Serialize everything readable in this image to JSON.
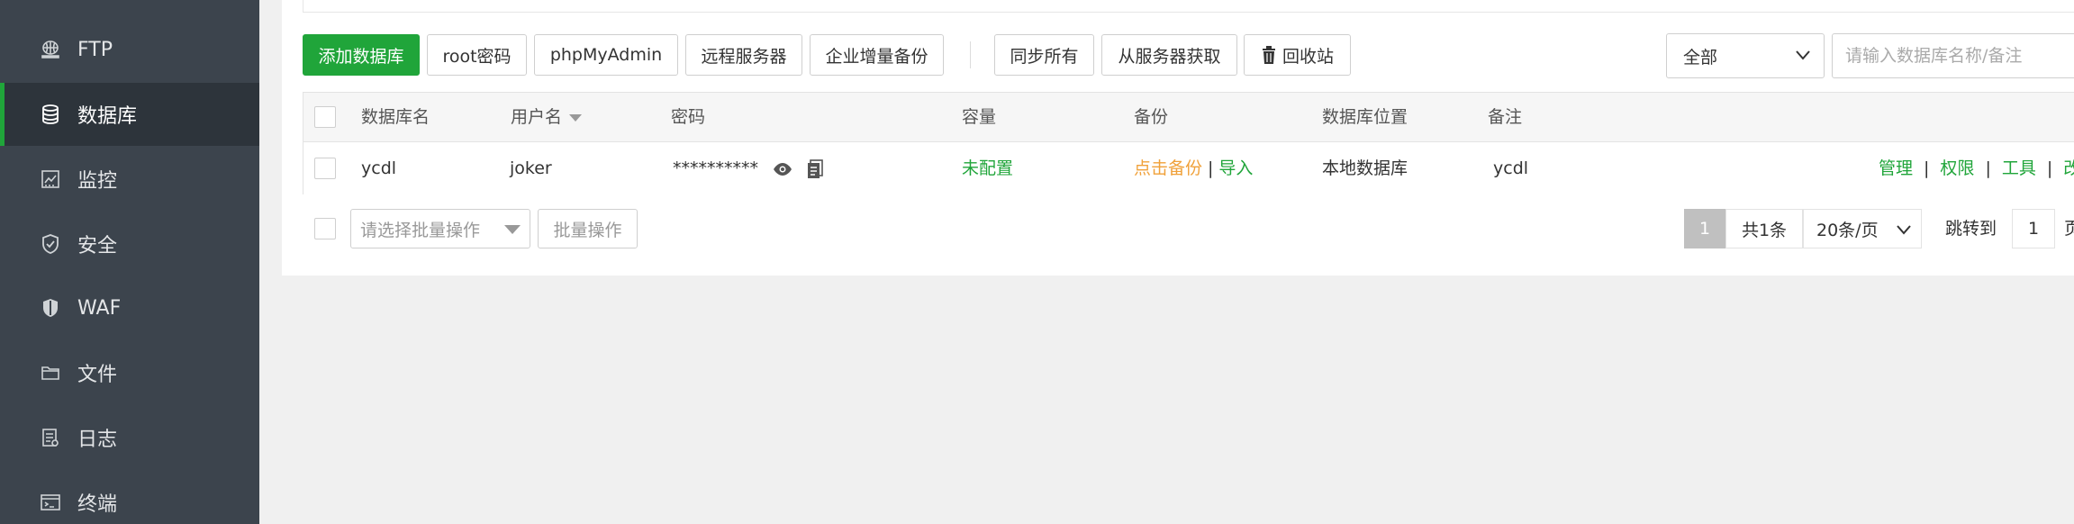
{
  "sidebar": {
    "items": [
      {
        "label": "FTP",
        "icon": "globe-icon",
        "active": false
      },
      {
        "label": "数据库",
        "icon": "database-icon",
        "active": true
      },
      {
        "label": "监控",
        "icon": "monitor-chart-icon",
        "active": false
      },
      {
        "label": "安全",
        "icon": "shield-check-icon",
        "active": false
      },
      {
        "label": "WAF",
        "icon": "waf-shield-icon",
        "active": false
      },
      {
        "label": "文件",
        "icon": "folder-icon",
        "active": false
      },
      {
        "label": "日志",
        "icon": "log-document-icon",
        "active": false
      },
      {
        "label": "终端",
        "icon": "terminal-icon",
        "active": false
      }
    ]
  },
  "toolbar": {
    "add_db": "添加数据库",
    "root_pwd": "root密码",
    "phpmyadmin": "phpMyAdmin",
    "remote_server": "远程服务器",
    "enterprise_backup": "企业增量备份",
    "sync_all": "同步所有",
    "fetch_from_server": "从服务器获取",
    "recycle_bin": "回收站",
    "filter_select": "全部",
    "search_placeholder": "请输入数据库名称/备注"
  },
  "table": {
    "headers": {
      "name": "数据库名",
      "user": "用户名",
      "password": "密码",
      "capacity": "容量",
      "backup": "备份",
      "location": "数据库位置",
      "note": "备注"
    },
    "rows": [
      {
        "name": "ycdl",
        "user": "joker",
        "password": "**********",
        "capacity": "未配置",
        "backup_action": "点击备份",
        "import_action": "导入",
        "location": "本地数据库",
        "note": "ycdl",
        "actions": {
          "manage": "管理",
          "permission": "权限",
          "tools": "工具",
          "edit": "改"
        }
      }
    ]
  },
  "footer": {
    "batch_placeholder": "请选择批量操作",
    "batch_button": "批量操作",
    "current_page": "1",
    "total": "共1条",
    "page_size": "20条/页",
    "jump_label": "跳转到",
    "jump_value": "1",
    "page_unit": "页"
  },
  "colors": {
    "sidebar_bg": "#3c444d",
    "accent_green": "#20a53a",
    "warning_orange": "#f0a13a"
  }
}
